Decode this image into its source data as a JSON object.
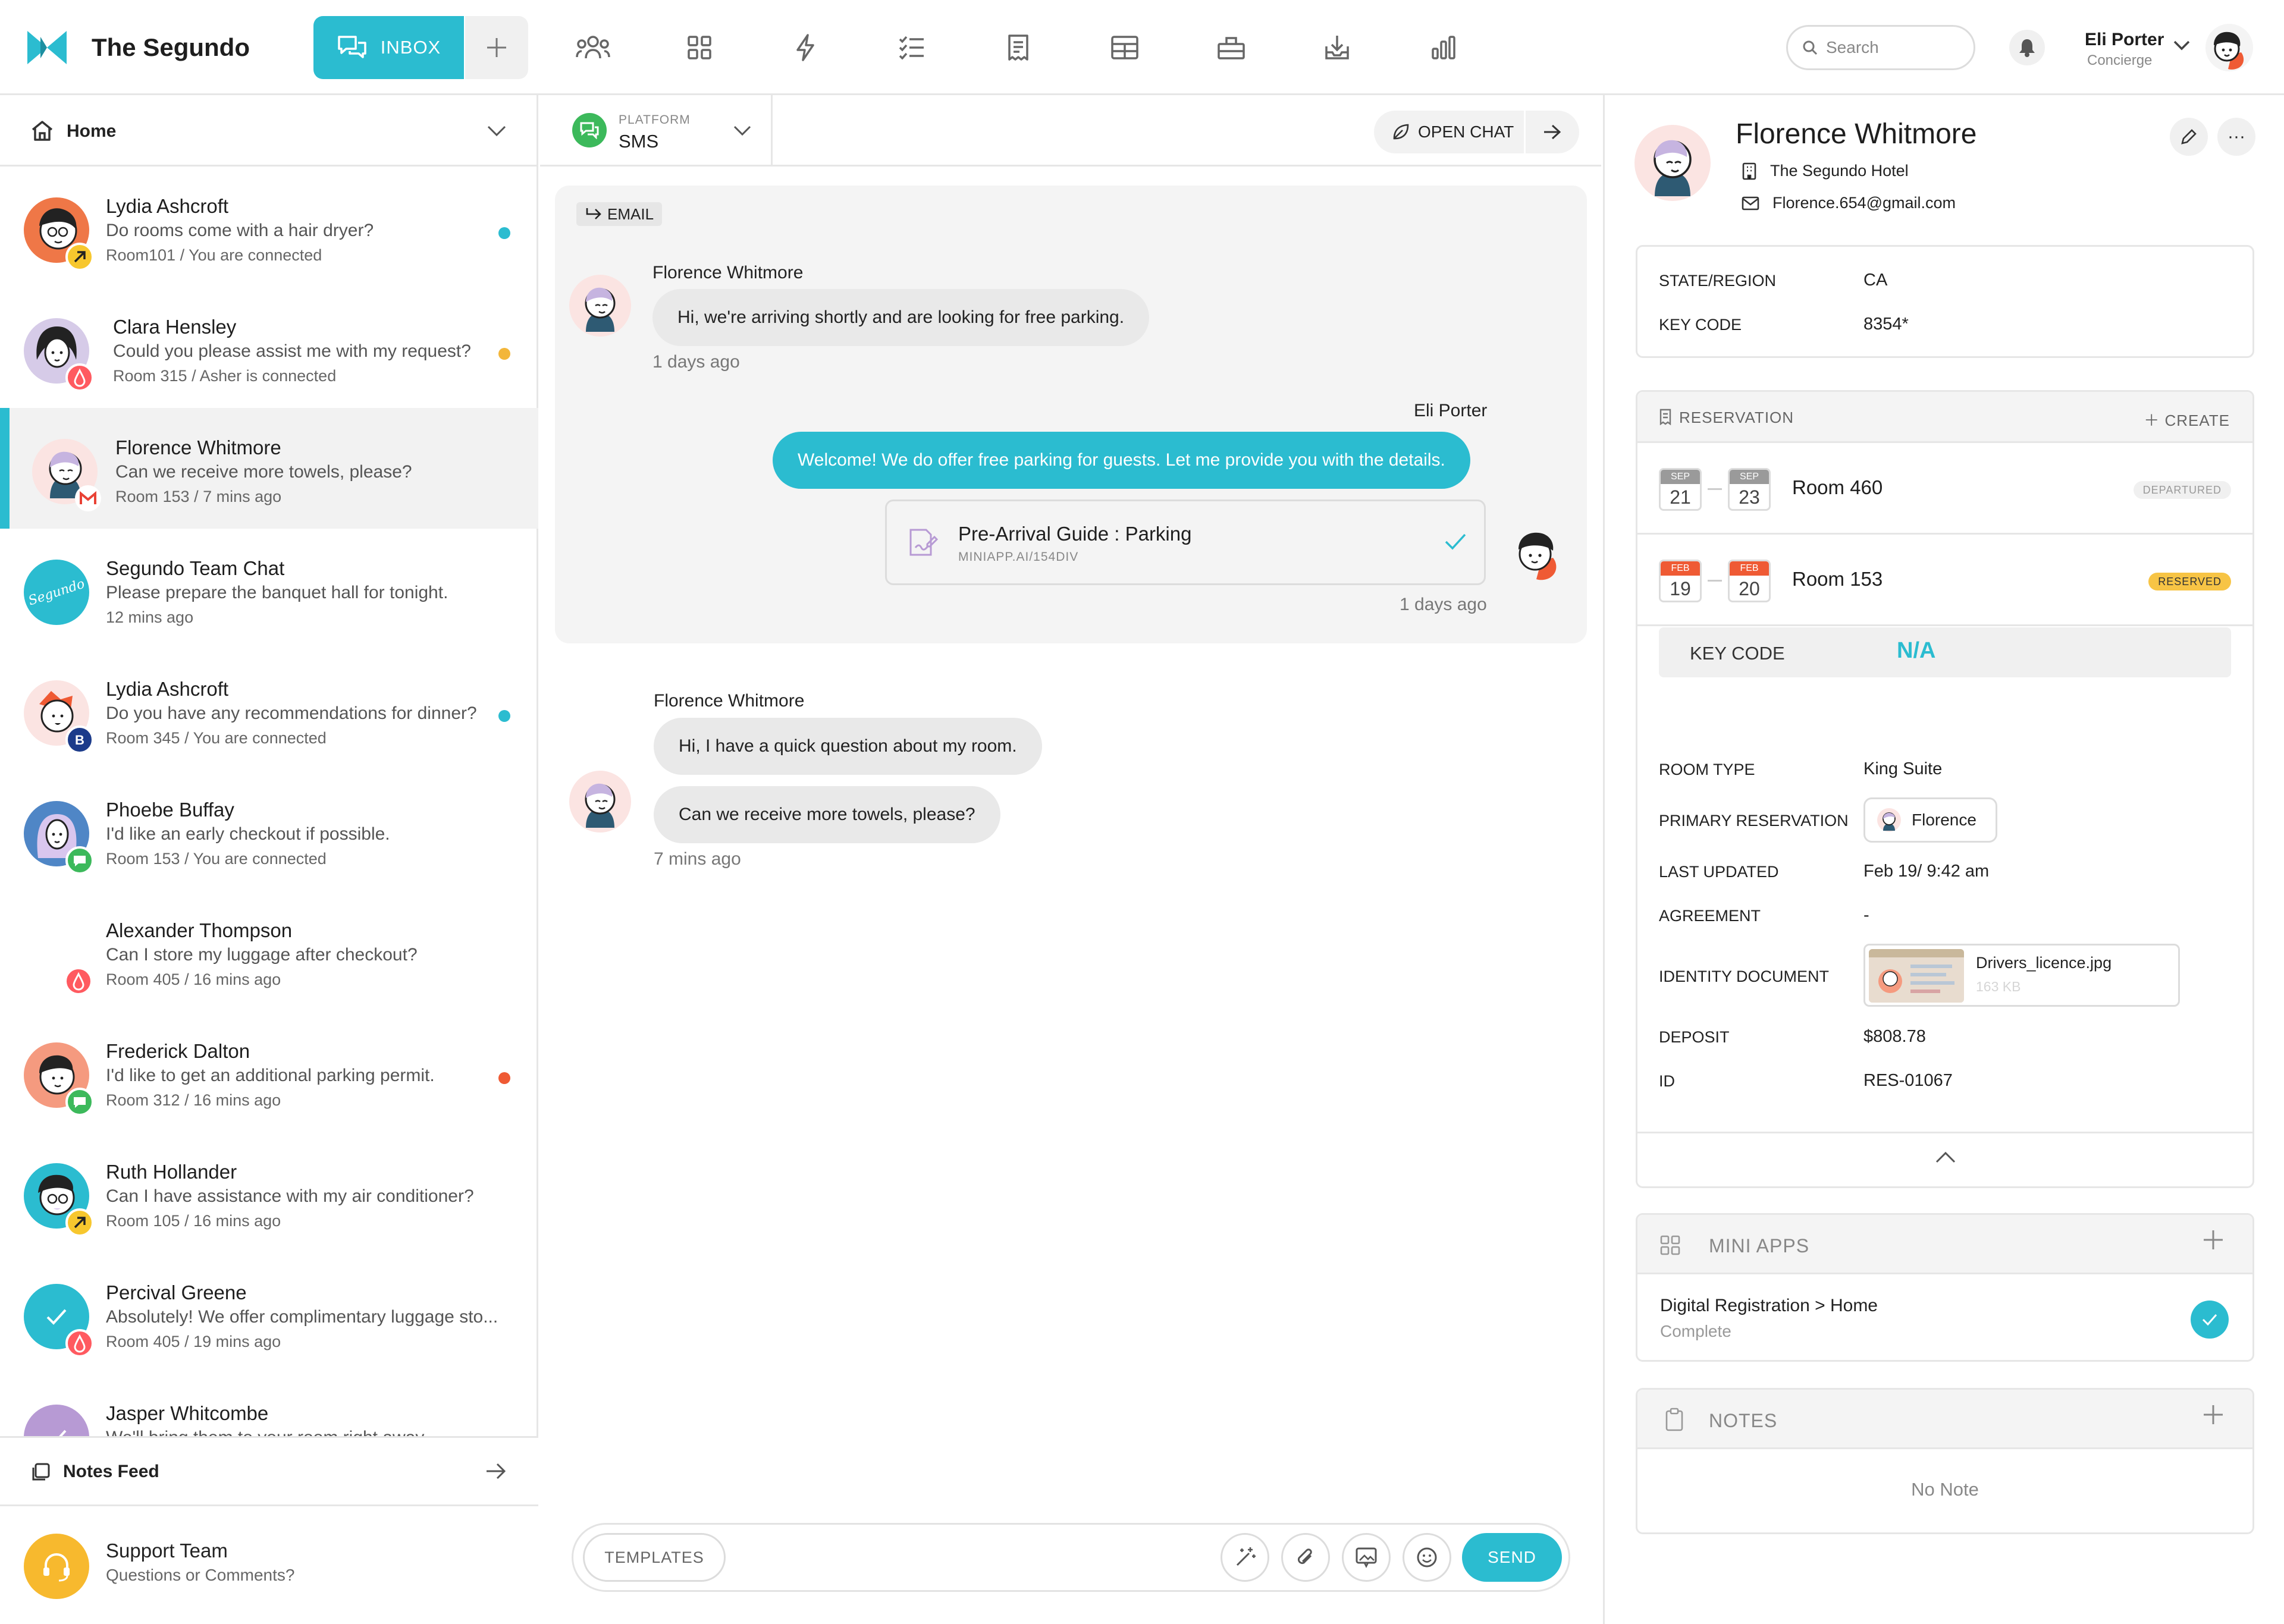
{
  "app": {
    "brand": "The Segundo",
    "accent": "#2bbcd0",
    "nav": {
      "inbox_label": "INBOX"
    },
    "search_placeholder": "Search",
    "user": {
      "name": "Eli Porter",
      "role": "Concierge"
    }
  },
  "sidebar": {
    "home_label": "Home",
    "conversations": [
      {
        "name": "Lydia Ashcroft",
        "message": "Do rooms come with a hair dryer?",
        "meta": "Room101 / You are connected",
        "dot": "#2bbcd0",
        "badge": "arrow-badge"
      },
      {
        "name": "Clara Hensley",
        "message": "Could you please assist me with my request?",
        "meta": "Room 315 / Asher is connected",
        "dot": "#f3b63a",
        "badge": "airbnb-badge"
      },
      {
        "name": "Florence Whitmore",
        "message": "Can we receive more towels, please?",
        "meta": "Room 153 / 7 mins ago",
        "dot": "",
        "badge": "gmail-badge"
      },
      {
        "name": "Segundo Team Chat",
        "message": "Please prepare the banquet hall for tonight.",
        "meta": "12 mins ago",
        "dot": "",
        "badge": ""
      },
      {
        "name": "Lydia Ashcroft",
        "message": "Do you have any recommendations for dinner?",
        "meta": "Room 345 / You are connected",
        "dot": "#2bbcd0",
        "badge": "booking-badge"
      },
      {
        "name": "Phoebe Buffay",
        "message": "I'd like an early checkout if possible.",
        "meta": "Room 153 / You are connected",
        "dot": "",
        "badge": "sms-badge"
      },
      {
        "name": "Alexander Thompson",
        "message": "Can I store my luggage after checkout?",
        "meta": "Room 405 / 16 mins ago",
        "dot": "",
        "badge": "airbnb-badge"
      },
      {
        "name": "Frederick Dalton",
        "message": "I'd like to get an additional parking permit.",
        "meta": "Room 312 / 16 mins ago",
        "dot": "#ef5a34",
        "badge": "sms-badge"
      },
      {
        "name": "Ruth Hollander",
        "message": "Can I have assistance with my air conditioner?",
        "meta": "Room 105 / 16 mins ago",
        "dot": "",
        "badge": "arrow-badge"
      },
      {
        "name": "Percival Greene",
        "message": "Absolutely! We offer complimentary luggage sto...",
        "meta": "Room 405 / 19 mins ago",
        "dot": "",
        "badge": "airbnb-badge"
      },
      {
        "name": "Jasper Whitcombe",
        "message": "We'll bring them to your room right away.",
        "meta": "",
        "dot": "",
        "badge": ""
      }
    ],
    "notes_feed_label": "Notes Feed",
    "support": {
      "name": "Support Team",
      "subtitle": "Questions or Comments?"
    }
  },
  "chat": {
    "platform_label": "PLATFORM",
    "platform_value": "SMS",
    "open_chat_label": "OPEN CHAT",
    "email_tag": "EMAIL",
    "messages": [
      {
        "sender": "Florence Whitmore",
        "text": "Hi, we're arriving shortly and are looking for free parking.",
        "time": "1 days ago"
      },
      {
        "sender": "Eli Porter",
        "text": "Welcome! We do offer free parking for guests. Let me provide you with the details.",
        "time": "1 days ago"
      },
      {
        "sender": "Florence Whitmore",
        "text": "Hi, I have a quick question about my room.",
        "time": ""
      },
      {
        "sender": "",
        "text": "Can we receive more towels, please?",
        "time": "7 mins ago"
      }
    ],
    "attachment": {
      "title": "Pre-Arrival Guide : Parking",
      "subtitle": "MINIAPP.AI/154DIV"
    },
    "composer": {
      "templates_label": "TEMPLATES",
      "send_label": "SEND"
    }
  },
  "guest": {
    "name": "Florence Whitmore",
    "hotel": "The Segundo Hotel",
    "email": "Florence.654@gmail.com",
    "state_label": "STATE/REGION",
    "state_value": "CA",
    "keycode_label": "KEY CODE",
    "keycode_value": "8354*",
    "reservation_title": "RESERVATION",
    "create_label": "CREATE",
    "reservations": [
      {
        "start_month": "SEP",
        "start_day": "21",
        "end_month": "SEP",
        "end_day": "23",
        "room": "Room 460",
        "status": "DEPARTURED"
      },
      {
        "start_month": "FEB",
        "start_day": "19",
        "end_month": "FEB",
        "end_day": "20",
        "room": "Room 153",
        "status": "RESERVED"
      }
    ],
    "key_code_band_label": "KEY CODE",
    "key_code_band_value": "N/A",
    "details": {
      "room_type_label": "ROOM TYPE",
      "room_type": "King Suite",
      "primary_label": "PRIMARY RESERVATION",
      "primary": "Florence",
      "updated_label": "LAST UPDATED",
      "updated": "Feb 19/ 9:42 am",
      "agreement_label": "AGREEMENT",
      "agreement": "-",
      "identity_label": "IDENTITY DOCUMENT",
      "identity_file": "Drivers_licence.jpg",
      "identity_size": "163 KB",
      "deposit_label": "DEPOSIT",
      "deposit": "$808.78",
      "id_label": "ID",
      "id": "RES-01067"
    },
    "mini_apps_title": "MINI APPS",
    "mini_app": {
      "title": "Digital Registration > Home",
      "status": "Complete"
    },
    "notes_title": "NOTES",
    "notes_empty": "No Note"
  }
}
